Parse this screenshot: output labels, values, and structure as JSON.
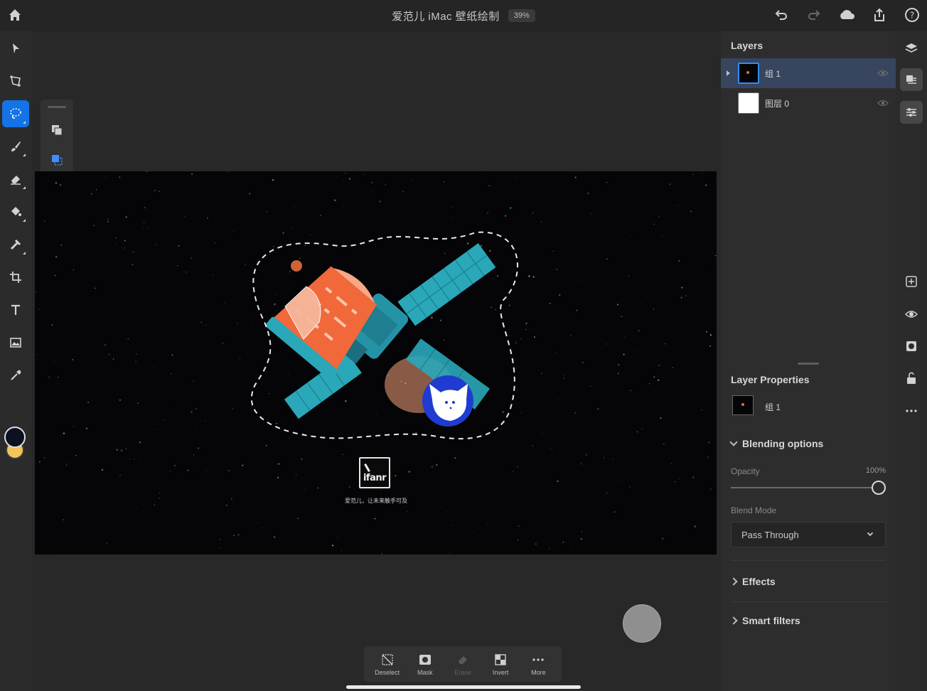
{
  "document": {
    "title": "爱范儿 iMac 壁纸绘制",
    "zoom": "39%"
  },
  "top_actions": [
    "undo-icon",
    "redo-icon",
    "cloud-icon",
    "share-icon",
    "help-icon"
  ],
  "toolbar": {
    "tools": [
      "select-icon",
      "transform-icon",
      "lasso-icon",
      "brush-icon",
      "eraser-icon",
      "fill-icon",
      "healing-icon",
      "crop-icon",
      "type-icon",
      "image-icon",
      "eyedropper-icon"
    ],
    "active_tool": "lasso-icon",
    "foreground_color": "#0c1020",
    "background_color": "#f2c45a"
  },
  "selection_subtools": [
    "add-selection-icon",
    "subtract-selection-icon",
    "intersect-selection-icon",
    "more-icon"
  ],
  "artwork": {
    "logo": "ifanr",
    "tagline": "爱范儿，让未来触手可及"
  },
  "taskbar": {
    "items": [
      {
        "label": "Deselect",
        "enabled": true
      },
      {
        "label": "Mask",
        "enabled": true
      },
      {
        "label": "Erase",
        "enabled": false
      },
      {
        "label": "Invert",
        "enabled": true
      },
      {
        "label": "More",
        "enabled": true
      }
    ]
  },
  "layers": {
    "title": "Layers",
    "items": [
      {
        "name": "组 1",
        "selected": true,
        "group": true
      },
      {
        "name": "图层 0",
        "selected": false,
        "group": false
      }
    ]
  },
  "properties": {
    "title": "Layer Properties",
    "layer_name": "组 1",
    "blending_label": "Blending options",
    "opacity_label": "Opacity",
    "opacity_value": "100%",
    "opacity": 1.0,
    "blend_mode_label": "Blend Mode",
    "blend_mode": "Pass Through",
    "effects_label": "Effects",
    "smart_filters_label": "Smart filters"
  },
  "colors": {
    "accent": "#1473e6",
    "selected_layer": "#37455e",
    "capsule_orange": "#f1683a",
    "panel_teal": "#2aa7b8"
  }
}
